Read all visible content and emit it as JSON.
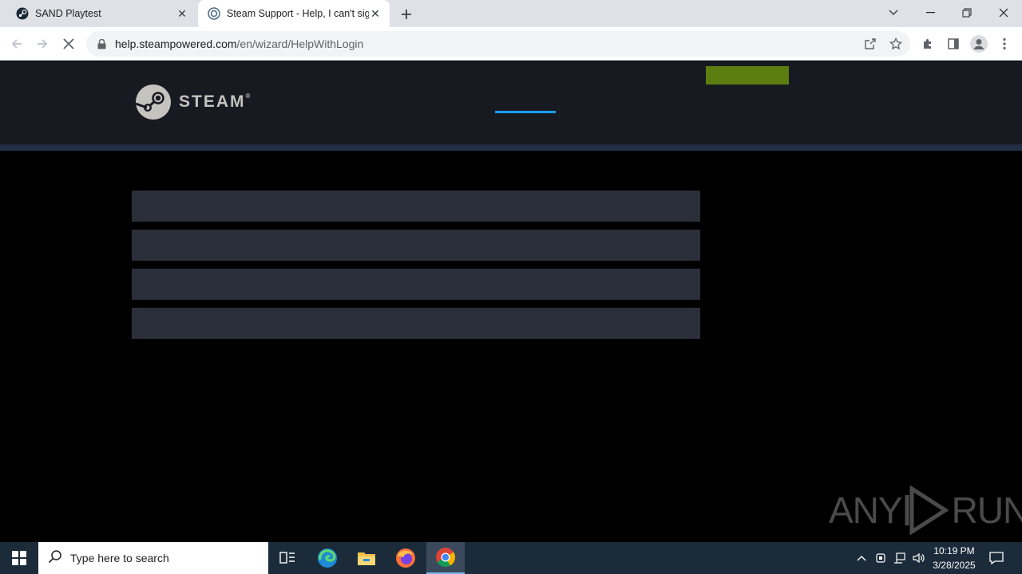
{
  "browser": {
    "tabs": [
      {
        "title": "SAND Playtest",
        "icon": "steam-icon"
      },
      {
        "title": "Steam Support - Help, I can't sig",
        "icon": "steam-support-icon"
      }
    ],
    "address": {
      "host": "help.steampowered.com",
      "path": "/en/wizard/HelpWithLogin"
    }
  },
  "page": {
    "logo_text": "STEAM",
    "registered": "®",
    "accent_color": "#1a9fff",
    "button_color": "#5c7e10"
  },
  "watermark": {
    "left": "ANY",
    "right": "RUN"
  },
  "taskbar": {
    "search_placeholder": "Type here to search",
    "time": "10:19 PM",
    "date": "3/28/2025"
  }
}
